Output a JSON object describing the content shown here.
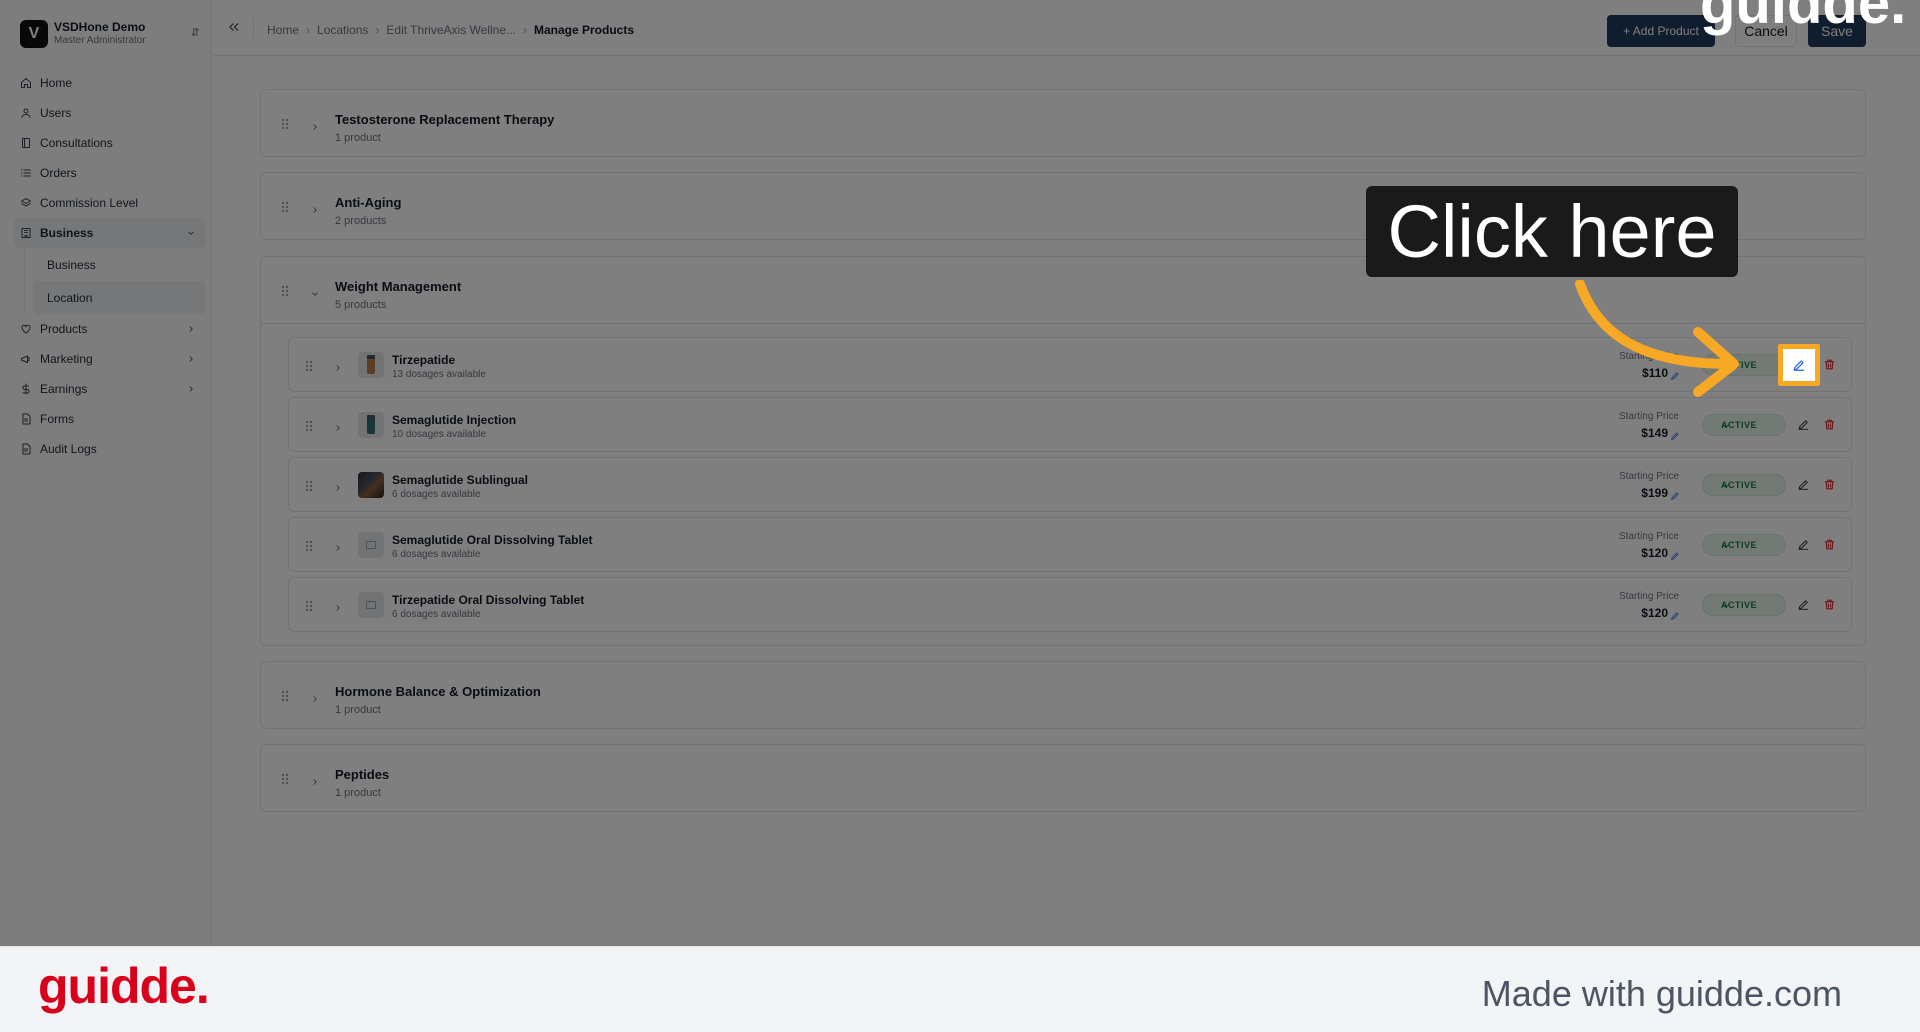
{
  "brand": {
    "initial": "V",
    "name": "VSDHone Demo",
    "role": "Master Administrator"
  },
  "sidebar": {
    "items": [
      {
        "label": "Home",
        "icon": "home-icon"
      },
      {
        "label": "Users",
        "icon": "user-icon"
      },
      {
        "label": "Consultations",
        "icon": "book-icon"
      },
      {
        "label": "Orders",
        "icon": "list-icon"
      },
      {
        "label": "Commission Level",
        "icon": "layers-icon"
      },
      {
        "label": "Business",
        "icon": "building-icon",
        "expanded": true
      },
      {
        "label": "Products",
        "icon": "heart-icon"
      },
      {
        "label": "Marketing",
        "icon": "megaphone-icon"
      },
      {
        "label": "Earnings",
        "icon": "dollar-icon"
      },
      {
        "label": "Forms",
        "icon": "file-icon"
      },
      {
        "label": "Audit Logs",
        "icon": "file-icon"
      }
    ],
    "business_sub": [
      {
        "label": "Business"
      },
      {
        "label": "Location",
        "active": true
      }
    ]
  },
  "topbar": {
    "breadcrumb": [
      "Home",
      "Locations",
      "Edit ThriveAxis Wellne...",
      "Manage Products"
    ],
    "add_product": "+ Add Product",
    "cancel": "Cancel",
    "save": "Save"
  },
  "categories": [
    {
      "title": "Testosterone Replacement Therapy",
      "count": "1 product"
    },
    {
      "title": "Anti-Aging",
      "count": "2 products"
    },
    {
      "title": "Weight Management",
      "count": "5 products"
    },
    {
      "title": "Hormone Balance & Optimization",
      "count": "1 product"
    },
    {
      "title": "Peptides",
      "count": "1 product"
    }
  ],
  "products": [
    {
      "name": "Tirzepatide",
      "dosages": "13 dosages available",
      "price_label": "Starting Price",
      "price": "$110",
      "status": "ACTIVE"
    },
    {
      "name": "Semaglutide Injection",
      "dosages": "10 dosages available",
      "price_label": "Starting Price",
      "price": "$149",
      "status": "ACTIVE"
    },
    {
      "name": "Semaglutide Sublingual",
      "dosages": "6 dosages available",
      "price_label": "Starting Price",
      "price": "$199",
      "status": "ACTIVE"
    },
    {
      "name": "Semaglutide Oral Dissolving Tablet",
      "dosages": "6 dosages available",
      "price_label": "Starting Price",
      "price": "$120",
      "status": "ACTIVE"
    },
    {
      "name": "Tirzepatide Oral Dissolving Tablet",
      "dosages": "6 dosages available",
      "price_label": "Starting Price",
      "price": "$120",
      "status": "ACTIVE"
    }
  ],
  "overlay": {
    "callout": "Click here",
    "watermark_top": "guidde.",
    "footer_logo": "guidde.",
    "footer_text": "Made with guidde.com",
    "accent": "#f7a825",
    "brand_red": "#d9001b"
  }
}
